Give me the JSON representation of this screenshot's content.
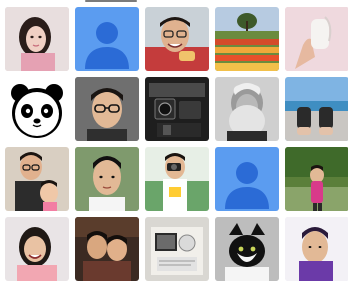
{
  "theme": {
    "placeholder_bg": "#5b9cf0",
    "placeholder_fg": "#2b6bd6"
  },
  "grid": {
    "rows": 4,
    "columns": 5,
    "items": [
      {
        "id": "r1c1",
        "kind": "photo",
        "subject": "woman-portrait-pink"
      },
      {
        "id": "r1c2",
        "kind": "placeholder",
        "icon": "default-avatar-icon"
      },
      {
        "id": "r1c3",
        "kind": "photo",
        "subject": "man-smiling-glasses"
      },
      {
        "id": "r1c4",
        "kind": "photo",
        "subject": "tulip-field-landscape"
      },
      {
        "id": "r1c5",
        "kind": "photo",
        "subject": "hand-holding-white-object"
      },
      {
        "id": "r2c1",
        "kind": "icon",
        "subject": "panda-face"
      },
      {
        "id": "r2c2",
        "kind": "photo",
        "subject": "man-with-glasses"
      },
      {
        "id": "r2c3",
        "kind": "photo",
        "subject": "camera-equipment-dark"
      },
      {
        "id": "r2c4",
        "kind": "photo",
        "subject": "bearded-man-bw"
      },
      {
        "id": "r2c5",
        "kind": "photo",
        "subject": "feet-seaside"
      },
      {
        "id": "r3c1",
        "kind": "photo",
        "subject": "man-with-child"
      },
      {
        "id": "r3c2",
        "kind": "photo",
        "subject": "young-man-portrait"
      },
      {
        "id": "r3c3",
        "kind": "photo",
        "subject": "woman-with-camera"
      },
      {
        "id": "r3c4",
        "kind": "placeholder",
        "icon": "default-avatar-icon"
      },
      {
        "id": "r3c5",
        "kind": "photo",
        "subject": "woman-outdoor-greenery"
      },
      {
        "id": "r4c1",
        "kind": "photo",
        "subject": "smiling-woman"
      },
      {
        "id": "r4c2",
        "kind": "photo",
        "subject": "couple-indoors"
      },
      {
        "id": "r4c3",
        "kind": "photo",
        "subject": "desk-items"
      },
      {
        "id": "r4c4",
        "kind": "photo",
        "subject": "black-white-cat"
      },
      {
        "id": "r4c5",
        "kind": "photo",
        "subject": "man-portrait-purple"
      }
    ]
  }
}
